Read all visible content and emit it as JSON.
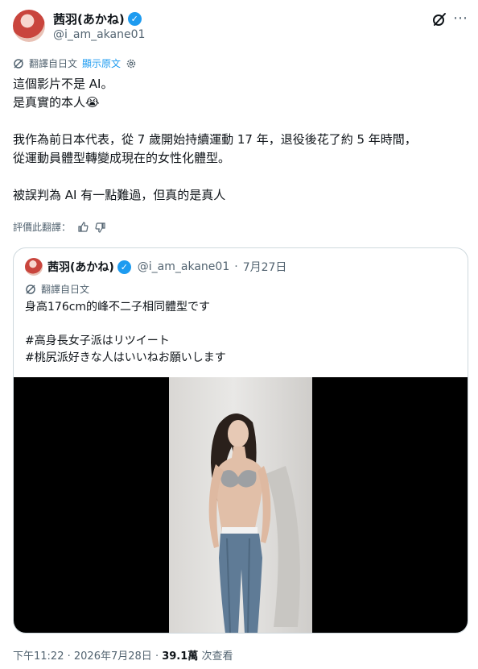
{
  "author": {
    "display_name": "茜羽(あかね)",
    "handle": "@i_am_akane01",
    "verified": true
  },
  "header_icons": [
    "grok-icon",
    "more-icon"
  ],
  "translation": {
    "label": "翻譯自日文",
    "show_original": "顯示原文"
  },
  "tweet_lines": [
    "這個影片不是 AI。",
    "是真實的本人😭",
    "",
    "我作為前日本代表，從 7 歲開始持續運動 17 年，退役後花了約 5 年時間，",
    "從運動員體型轉變成現在的女性化體型。",
    "",
    "被誤判為 AI 有一點難過，但真的是真人"
  ],
  "rate_translation": {
    "label": "評價此翻譯："
  },
  "quoted": {
    "display_name": "茜羽(あかね)",
    "handle": "@i_am_akane01",
    "separator": "·",
    "date": "7月27日",
    "translation_label": "翻譯自日文",
    "lines": [
      "身高176cm的峰不二子相同體型です",
      "",
      "#高身長女子派はリツイート",
      "#桃尻派好きな人はいいねお願いします"
    ]
  },
  "footer": {
    "time": "下午11:22",
    "sep1": "·",
    "date": "2026年7月28日",
    "sep2": "·",
    "views_count": "39.1萬",
    "views_label": "次查看"
  },
  "colors": {
    "accent": "#1d9bf0",
    "text": "#0f1419",
    "muted": "#536471",
    "border": "#cfd9de"
  }
}
